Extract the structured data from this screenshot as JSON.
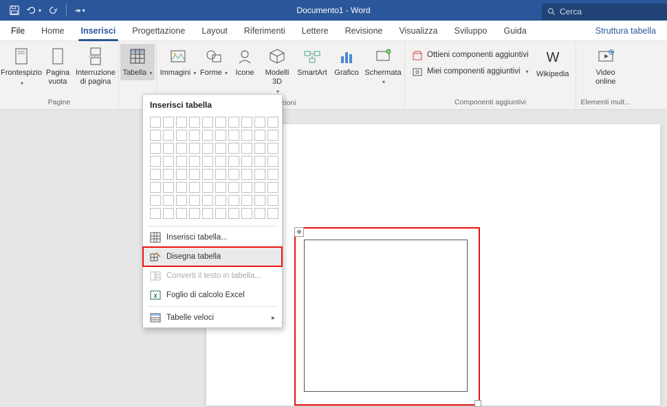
{
  "titlebar": {
    "title": "Documento1 - Word",
    "search_placeholder": "Cerca"
  },
  "tabs": {
    "file": "File",
    "home": "Home",
    "insert": "Inserisci",
    "design": "Progettazione",
    "layout": "Layout",
    "references": "Riferimenti",
    "mailings": "Lettere",
    "review": "Revisione",
    "view": "Visualizza",
    "developer": "Sviluppo",
    "help": "Guida",
    "context": "Struttura tabella"
  },
  "ribbon": {
    "pages": {
      "label": "Pagine",
      "cover": "Frontespizio",
      "blank": "Pagina\nvuota",
      "break": "Interruzione\ndi pagina"
    },
    "tables": {
      "table": "Tabella"
    },
    "illustrations": {
      "label": "ustrazioni",
      "images": "Immagini",
      "shapes": "Forme",
      "icons": "Icone",
      "models3d": "Modelli\n3D",
      "smartart": "SmartArt",
      "chart": "Grafico",
      "screenshot": "Schermata"
    },
    "addins": {
      "label": "Componenti aggiuntivi",
      "get": "Ottieni componenti aggiuntivi",
      "my": "Miei componenti aggiuntivi",
      "wikipedia": "Wikipedia"
    },
    "media": {
      "label": "Elementi mult...",
      "video": "Video\nonline"
    }
  },
  "dropdown": {
    "title": "Inserisci tabella",
    "insert": "Inserisci tabella...",
    "draw": "Disegna tabella",
    "convert": "Converti il testo in tabella...",
    "excel": "Foglio di calcolo Excel",
    "quick": "Tabelle veloci"
  }
}
